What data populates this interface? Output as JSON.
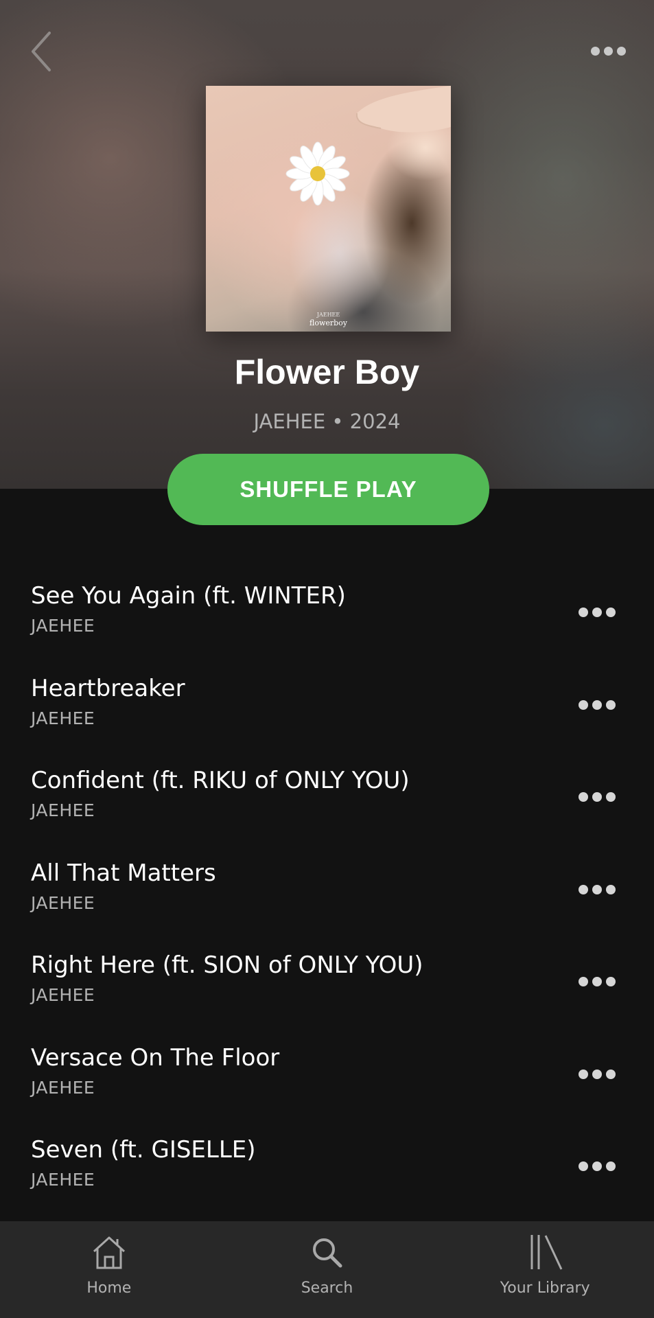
{
  "header": {
    "back_icon": "chevron-left-icon",
    "more_icon": "more-horizontal-icon"
  },
  "album": {
    "cover_artist_text": "JAEHEE",
    "cover_title_text": "flowerboy",
    "title": "Flower Boy",
    "meta": "JAEHEE • 2024"
  },
  "shuffle": {
    "label": "SHUFFLE PLAY",
    "color": "#52b955"
  },
  "tracks": [
    {
      "title": "See You Again (ft. WINTER)",
      "artist": "JAEHEE"
    },
    {
      "title": "Heartbreaker",
      "artist": "JAEHEE"
    },
    {
      "title": "Confident (ft. RIKU of ONLY YOU)",
      "artist": "JAEHEE"
    },
    {
      "title": "All That Matters",
      "artist": "JAEHEE"
    },
    {
      "title": "Right Here (ft. SION of ONLY YOU)",
      "artist": "JAEHEE"
    },
    {
      "title": "Versace On The Floor",
      "artist": "JAEHEE"
    },
    {
      "title": "Seven (ft. GISELLE)",
      "artist": "JAEHEE"
    }
  ],
  "tabbar": {
    "tabs": [
      {
        "label": "Home",
        "icon": "home-icon"
      },
      {
        "label": "Search",
        "icon": "search-icon"
      },
      {
        "label": "Your Library",
        "icon": "library-icon"
      }
    ]
  }
}
